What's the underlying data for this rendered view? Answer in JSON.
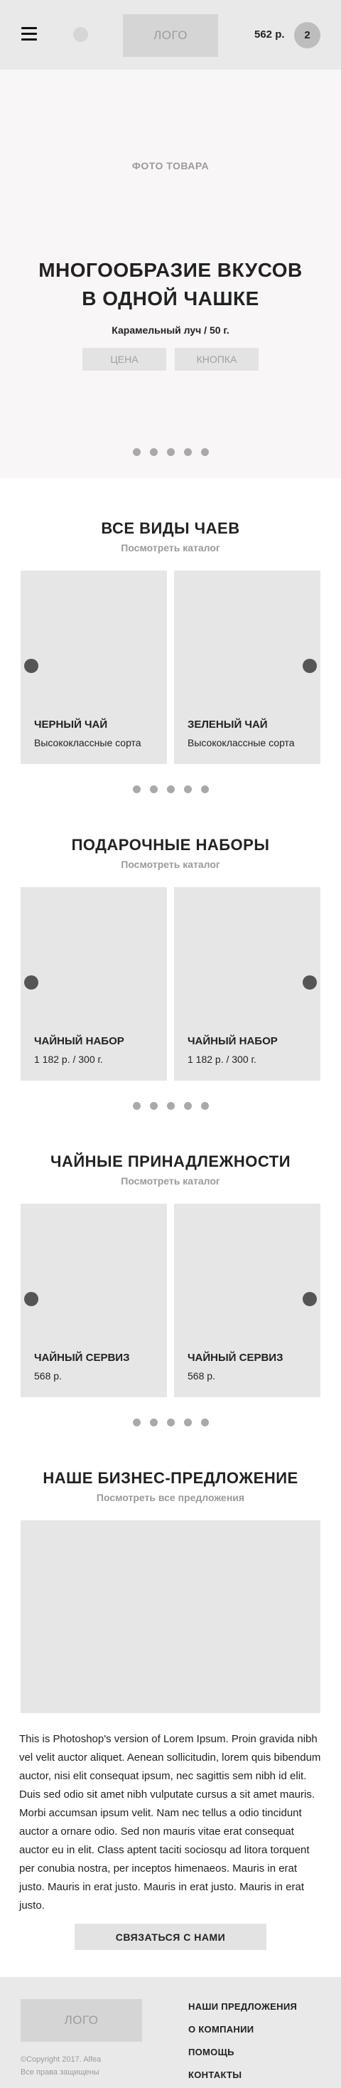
{
  "header": {
    "logo": "ЛОГО",
    "price": "562 р.",
    "cart_count": "2"
  },
  "hero": {
    "photo_label": "ФОТО ТОВАРА",
    "title_line1": "МНОГООБРАЗИЕ ВКУСОВ",
    "title_line2": "В ОДНОЙ ЧАШКЕ",
    "subtitle": "Карамельный луч / 50 г.",
    "btn_price": "ЦЕНА",
    "btn_button": "КНОПКА",
    "slide_count": 5
  },
  "sections": {
    "teas": {
      "title": "ВСЕ ВИДЫ ЧАЕВ",
      "link": "Посмотреть каталог",
      "cards": [
        {
          "title": "ЧЕРНЫЙ ЧАЙ",
          "sub": "Высококлассные сорта"
        },
        {
          "title": "ЗЕЛЕНЫЙ ЧАЙ",
          "sub": "Высококлассные сорта"
        }
      ]
    },
    "gifts": {
      "title": "ПОДАРОЧНЫЕ НАБОРЫ",
      "link": "Посмотреть каталог",
      "cards": [
        {
          "title": "ЧАЙНЫЙ НАБОР",
          "sub": "1 182 р. / 300 г."
        },
        {
          "title": "ЧАЙНЫЙ НАБОР",
          "sub": "1 182 р. / 300 г."
        }
      ]
    },
    "accessories": {
      "title": "ЧАЙНЫЕ ПРИНАДЛЕЖНОСТИ",
      "link": "Посмотреть каталог",
      "cards": [
        {
          "title": "ЧАЙНЫЙ СЕРВИЗ",
          "sub": "568 р."
        },
        {
          "title": "ЧАЙНЫЙ СЕРВИЗ",
          "sub": "568 р."
        }
      ]
    }
  },
  "business": {
    "title": "НАШЕ БИЗНЕС-ПРЕДЛОЖЕНИЕ",
    "link": "Посмотреть все предложения",
    "text": "This is Photoshop's version  of Lorem Ipsum. Proin gravida nibh vel velit auctor aliquet. Aenean sollicitudin, lorem quis bibendum auctor, nisi elit consequat ipsum, nec sagittis sem nibh id elit. Duis sed odio sit amet nibh vulputate cursus a sit amet mauris. Morbi accumsan ipsum velit. Nam nec tellus a odio tincidunt auctor a ornare odio. Sed non  mauris vitae erat consequat auctor eu in elit. Class aptent taciti sociosqu ad litora torquent per conubia nostra, per inceptos himenaeos. Mauris in erat justo. Mauris in erat justo. Mauris in erat justo. Mauris in erat justo.",
    "button": "СВЯЗАТЬСЯ С НАМИ"
  },
  "footer": {
    "logo": "ЛОГО",
    "copyright": "©Copyright 2017.  Alfea",
    "rights": "Все права защищены",
    "nav": [
      "НАШИ ПРЕДЛОЖЕНИЯ",
      "О КОМПАНИИ",
      "ПОМОЩЬ",
      "КОНТАКТЫ"
    ]
  }
}
